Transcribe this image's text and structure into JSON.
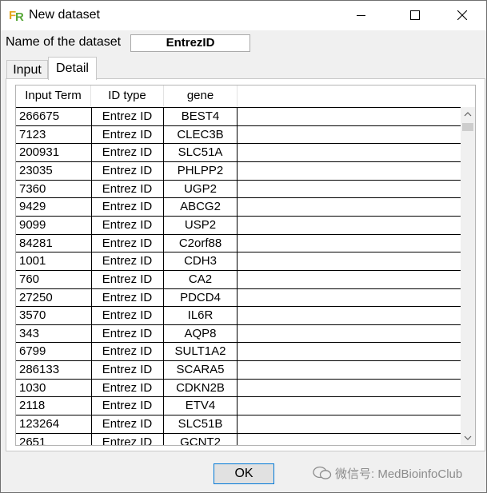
{
  "window": {
    "title": "New dataset",
    "icon": "app-icon-fr"
  },
  "form": {
    "name_label": "Name of the dataset",
    "name_value": "EntrezID"
  },
  "tabs": [
    {
      "label": "Input",
      "active": false
    },
    {
      "label": "Detail",
      "active": true
    }
  ],
  "table": {
    "columns": [
      "Input Term",
      "ID type",
      "gene"
    ],
    "rows": [
      [
        "266675",
        "Entrez ID",
        "BEST4"
      ],
      [
        "7123",
        "Entrez ID",
        "CLEC3B"
      ],
      [
        "200931",
        "Entrez ID",
        "SLC51A"
      ],
      [
        "23035",
        "Entrez ID",
        "PHLPP2"
      ],
      [
        "7360",
        "Entrez ID",
        "UGP2"
      ],
      [
        "9429",
        "Entrez ID",
        "ABCG2"
      ],
      [
        "9099",
        "Entrez ID",
        "USP2"
      ],
      [
        "84281",
        "Entrez ID",
        "C2orf88"
      ],
      [
        "1001",
        "Entrez ID",
        "CDH3"
      ],
      [
        "760",
        "Entrez ID",
        "CA2"
      ],
      [
        "27250",
        "Entrez ID",
        "PDCD4"
      ],
      [
        "3570",
        "Entrez ID",
        "IL6R"
      ],
      [
        "343",
        "Entrez ID",
        "AQP8"
      ],
      [
        "6799",
        "Entrez ID",
        "SULT1A2"
      ],
      [
        "286133",
        "Entrez ID",
        "SCARA5"
      ],
      [
        "1030",
        "Entrez ID",
        "CDKN2B"
      ],
      [
        "2118",
        "Entrez ID",
        "ETV4"
      ],
      [
        "123264",
        "Entrez ID",
        "SLC51B"
      ],
      [
        "2651",
        "Entrez ID",
        "GCNT2"
      ]
    ]
  },
  "buttons": {
    "ok": "OK"
  },
  "watermark": {
    "text": "微信号: MedBioinfoClub"
  }
}
